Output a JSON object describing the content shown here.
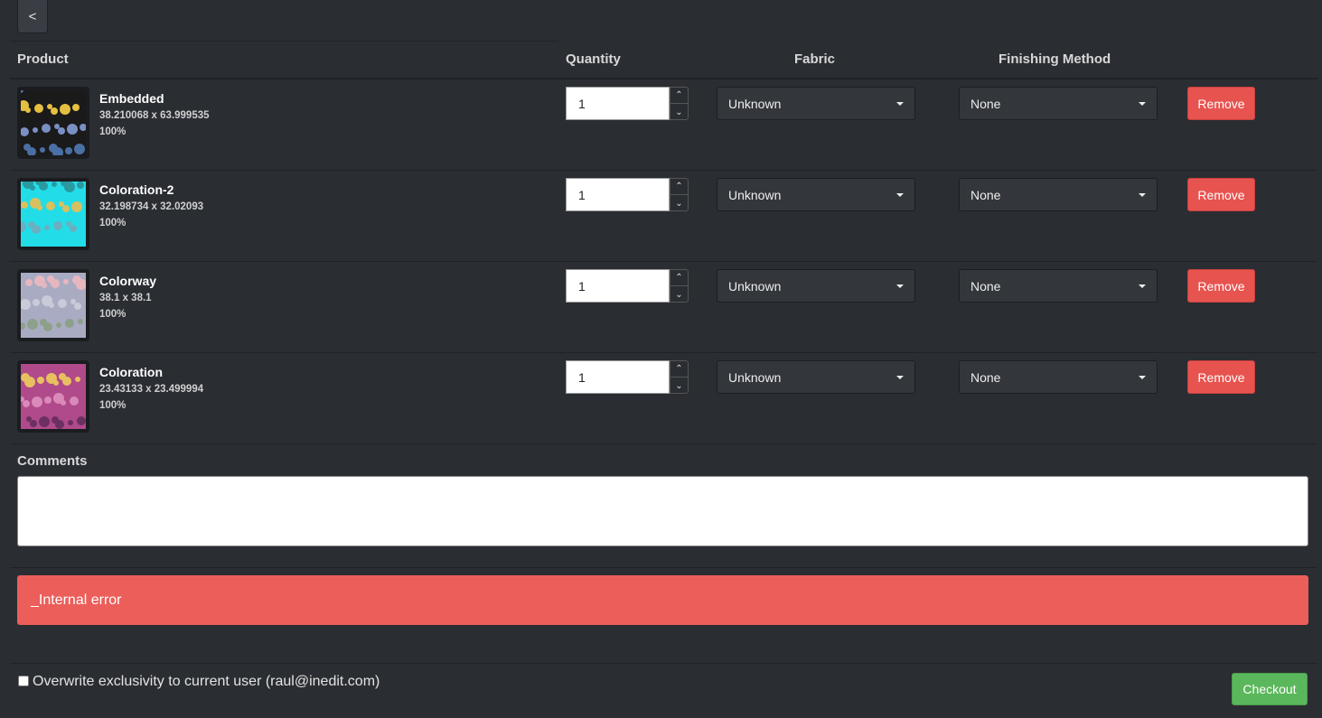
{
  "back_label": "<",
  "headers": {
    "product": "Product",
    "quantity": "Quantity",
    "fabric": "Fabric",
    "finishing": "Finishing Method"
  },
  "rows": [
    {
      "name": "Embedded",
      "dims": "38.210068 x 63.999535",
      "scale": "100%",
      "quantity": "1",
      "fabric": "Unknown",
      "finishing": "None",
      "remove": "Remove",
      "thumb_pattern": "dark-floral",
      "thumb_colors": [
        "#1a1a1a",
        "#4a6fa5",
        "#e5c040",
        "#7a8fc4"
      ]
    },
    {
      "name": "Coloration-2",
      "dims": "32.198734 x 32.02093",
      "scale": "100%",
      "quantity": "1",
      "fabric": "Unknown",
      "finishing": "None",
      "remove": "Remove",
      "thumb_pattern": "cyan-floral",
      "thumb_colors": [
        "#22dde8",
        "#2a9aa0",
        "#d8c060",
        "#6ab0c0"
      ]
    },
    {
      "name": "Colorway",
      "dims": "38.1 x 38.1",
      "scale": "100%",
      "quantity": "1",
      "fabric": "Unknown",
      "finishing": "None",
      "remove": "Remove",
      "thumb_pattern": "pastel-floral",
      "thumb_colors": [
        "#a9abc2",
        "#e7b7c0",
        "#c9cbd8",
        "#8da08a"
      ]
    },
    {
      "name": "Coloration",
      "dims": "23.43133 x 23.499994",
      "scale": "100%",
      "quantity": "1",
      "fabric": "Unknown",
      "finishing": "None",
      "remove": "Remove",
      "thumb_pattern": "pink-floral",
      "thumb_colors": [
        "#b04a8a",
        "#e8c060",
        "#d98ab8",
        "#6b3060"
      ]
    }
  ],
  "comments_label": "Comments",
  "comments_value": "",
  "alert_text": "_Internal error",
  "exclusivity_label": "Overwrite exclusivity to current user (raul@inedit.com)",
  "exclusivity_checked": false,
  "checkout_label": "Checkout",
  "colors": {
    "background": "#2a2d32",
    "remove": "#e7534f",
    "alert": "#ec5e5a",
    "checkout": "#5bb75b"
  }
}
